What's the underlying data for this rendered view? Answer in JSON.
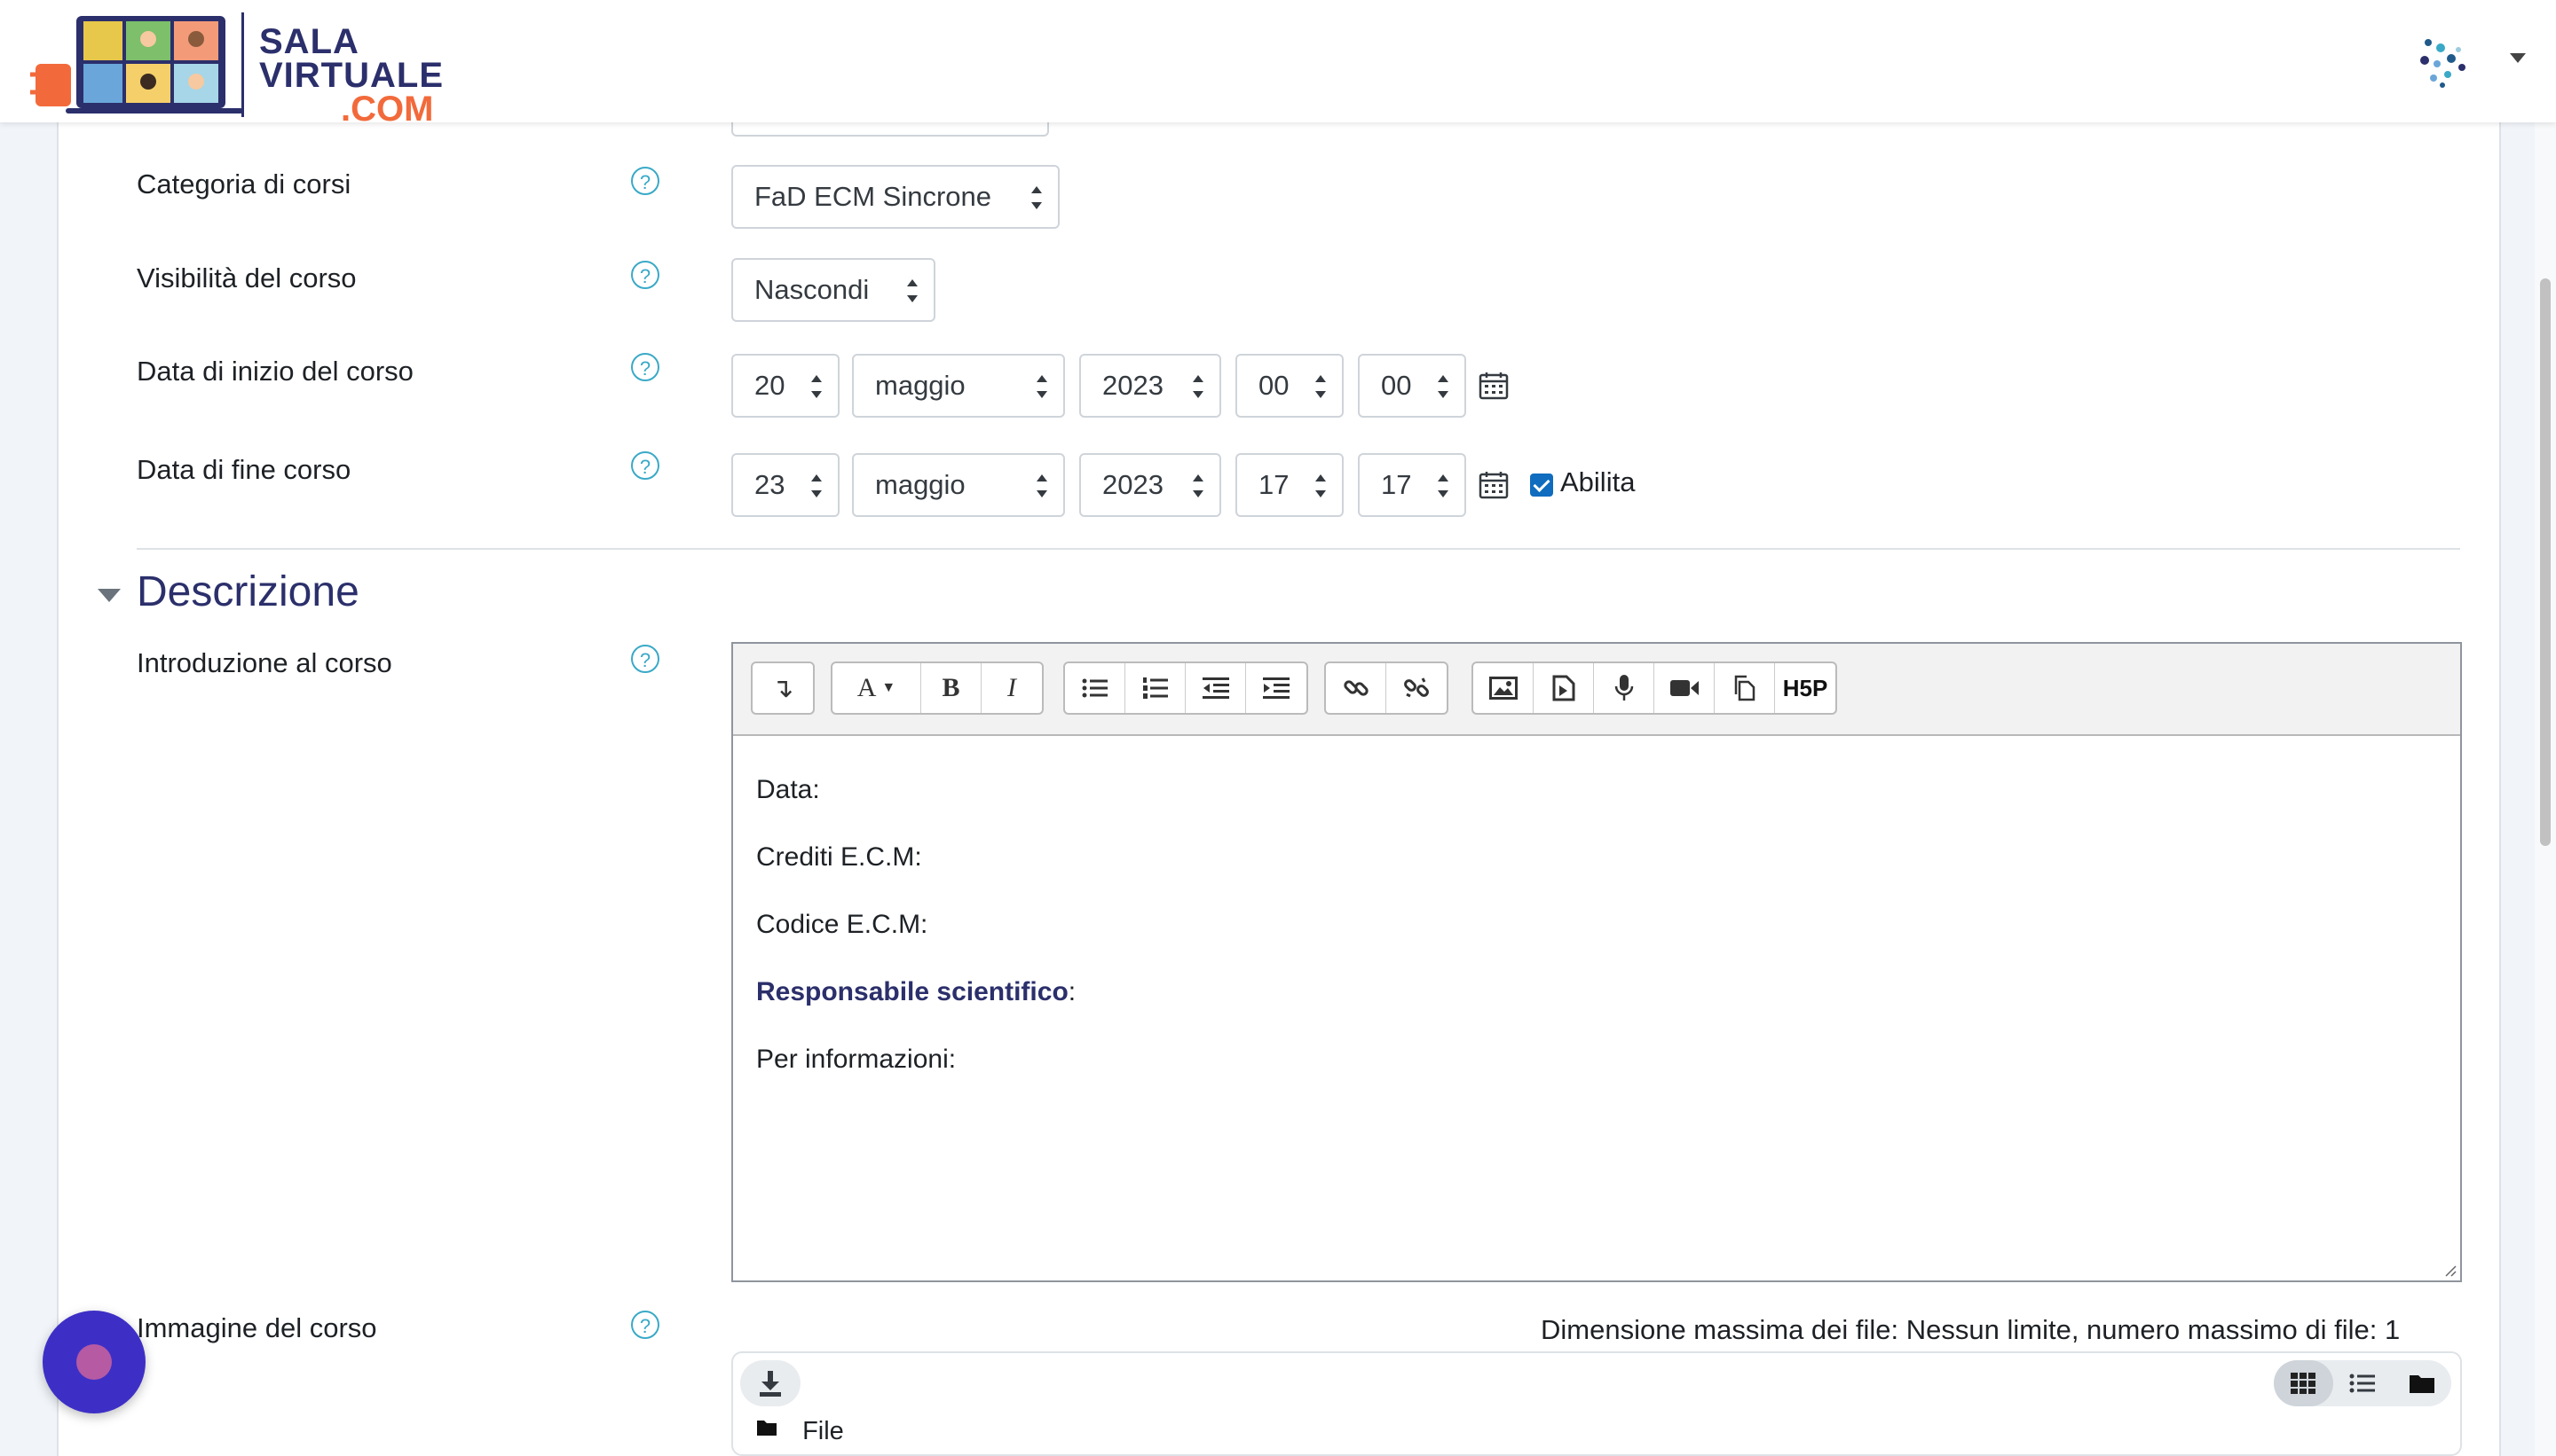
{
  "header": {
    "logo_line1": "SALA",
    "logo_line2": "VIRTUALE",
    "logo_line3": ".COM",
    "brand_colors": {
      "primary": "#2b2f6b",
      "accent": "#f26a3b"
    }
  },
  "form": {
    "categoria": {
      "label": "Categoria di corsi",
      "value": "FaD ECM Sincrone"
    },
    "visibilita": {
      "label": "Visibilità del corso",
      "value": "Nascondi"
    },
    "data_inizio": {
      "label": "Data di inizio del corso",
      "day": "20",
      "month": "maggio",
      "year": "2023",
      "hour": "00",
      "minute": "00"
    },
    "data_fine": {
      "label": "Data di fine corso",
      "day": "23",
      "month": "maggio",
      "year": "2023",
      "hour": "17",
      "minute": "17",
      "enable_label": "Abilita",
      "enabled": true
    },
    "help_glyph": "?"
  },
  "descrizione": {
    "section_title": "Descrizione",
    "intro_label": "Introduzione al corso",
    "toolbar_icons": [
      "collapse-icon",
      "font-style-icon",
      "bold-icon",
      "italic-icon",
      "bulleted-list-icon",
      "numbered-list-icon",
      "outdent-icon",
      "indent-icon",
      "link-icon",
      "unlink-icon",
      "image-icon",
      "media-icon",
      "record-audio-icon",
      "record-video-icon",
      "manage-files-icon",
      "h5p-icon"
    ],
    "toolbar_text": {
      "collapse": "↴",
      "font": "A",
      "bold": "B",
      "italic": "I",
      "h5p": "H5P"
    },
    "content": {
      "line1": "Data:",
      "line2": "Crediti E.C.M:",
      "line3": "Codice E.C.M:",
      "line4_strong": "Responsabile scientifico",
      "line4_rest": ":",
      "line5": "Per informazioni:"
    }
  },
  "immagine": {
    "label": "Immagine del corso",
    "max_files_text": "Dimensione massima dei file: Nessun limite, numero massimo di file: 1",
    "folder_label": "File"
  }
}
